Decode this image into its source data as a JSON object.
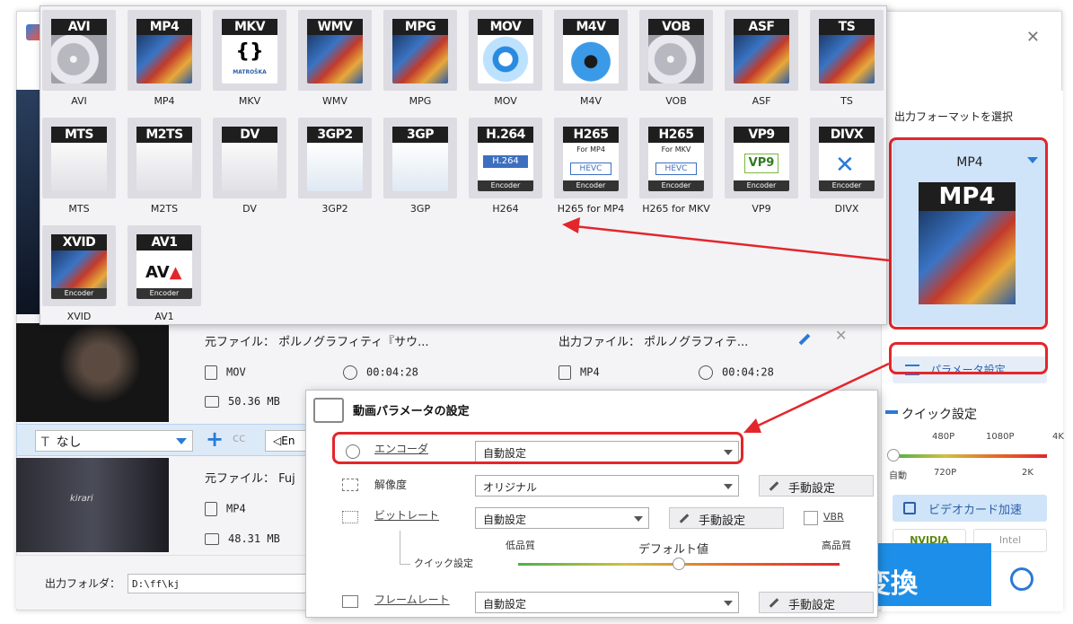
{
  "colors": {
    "accent": "#2a7ad6",
    "highlight_red": "#e3262b",
    "convert_blue": "#1e8fe8"
  },
  "right_panel": {
    "output_format_title": "出力フォーマットを選択",
    "selected_format": "MP4",
    "selected_format_badge": "MP4",
    "parameter_settings": "パラメータ設定",
    "quick_settings": "クイック設定",
    "quality_ticks_top": [
      "480P",
      "1080P",
      "4K"
    ],
    "quality_ticks_bottom": [
      "自動",
      "720P",
      "2K"
    ],
    "gpu_accel": "ビデオカード加速",
    "vendors": [
      "NVIDIA",
      "Intel"
    ]
  },
  "format_popup": {
    "formats": [
      {
        "badge": "AVI",
        "label": "AVI",
        "art": "disc"
      },
      {
        "badge": "MP4",
        "label": "MP4",
        "art": "film"
      },
      {
        "badge": "MKV",
        "label": "MKV",
        "art": "mkv"
      },
      {
        "badge": "WMV",
        "label": "WMV",
        "art": "film"
      },
      {
        "badge": "MPG",
        "label": "MPG",
        "art": "film"
      },
      {
        "badge": "MOV",
        "label": "MOV",
        "art": "mov"
      },
      {
        "badge": "M4V",
        "label": "M4V",
        "art": "m4v"
      },
      {
        "badge": "VOB",
        "label": "VOB",
        "art": "disc"
      },
      {
        "badge": "ASF",
        "label": "ASF",
        "art": "film"
      },
      {
        "badge": "TS",
        "label": "TS",
        "art": "film"
      },
      {
        "badge": "MTS",
        "label": "MTS",
        "art": "cam"
      },
      {
        "badge": "M2TS",
        "label": "M2TS",
        "art": "cam"
      },
      {
        "badge": "DV",
        "label": "DV",
        "art": "cam"
      },
      {
        "badge": "3GP2",
        "label": "3GP2",
        "art": "phone"
      },
      {
        "badge": "3GP",
        "label": "3GP",
        "art": "phone"
      },
      {
        "badge": "H.264",
        "label": "H264",
        "art": "h264"
      },
      {
        "badge": "H265",
        "label": "H265 for MP4",
        "art": "hevc",
        "sub": "For MP4"
      },
      {
        "badge": "H265",
        "label": "H265 for MKV",
        "art": "hevc",
        "sub": "For MKV"
      },
      {
        "badge": "VP9",
        "label": "VP9",
        "art": "vp9"
      },
      {
        "badge": "DIVX",
        "label": "DIVX",
        "art": "divx"
      },
      {
        "badge": "XVID",
        "label": "XVID",
        "art": "xvid"
      },
      {
        "badge": "AV1",
        "label": "AV1",
        "art": "av1"
      }
    ],
    "encoder_strip": "Encoder",
    "h264_inner": "H.264",
    "hevc_inner": "HEVC",
    "vp9_inner": "VP9",
    "mkv_inner": "MATROŠKA"
  },
  "file_rows": [
    {
      "source_label": "元ファイル：",
      "source_name": "ポルノグラフィティ『サウ...",
      "output_label": "出力ファイル：",
      "output_name": "ポルノグラフィテ...",
      "src_format": "MOV",
      "src_duration": "00:04:28",
      "src_size": "50.36 MB",
      "out_format": "MP4",
      "out_duration": "00:04:28"
    },
    {
      "source_label": "元ファイル：",
      "source_name": "Fuj",
      "src_format": "MP4",
      "src_size": "48.31 MB"
    }
  ],
  "thumb_caption": "kirari",
  "subtitle_bar": {
    "subtitle_value": "なし",
    "audio_prefix": "En"
  },
  "bottom": {
    "output_folder_label": "出力フォルダ：",
    "output_path": "D:\\ff\\kj",
    "convert_label": "変換"
  },
  "param_dialog": {
    "title": "動画パラメータの設定",
    "encoder_label": "エンコーダ",
    "encoder_value": "自動設定",
    "resolution_label": "解像度",
    "resolution_value": "オリジナル",
    "manual_label": "手動設定",
    "bitrate_label": "ビットレート",
    "bitrate_value": "自動設定",
    "vbr_label": "VBR",
    "quick_label": "クイック設定",
    "low_quality": "低品質",
    "default_value": "デフォルト値",
    "high_quality": "高品質",
    "framerate_label": "フレームレート",
    "framerate_value": "自動設定"
  }
}
